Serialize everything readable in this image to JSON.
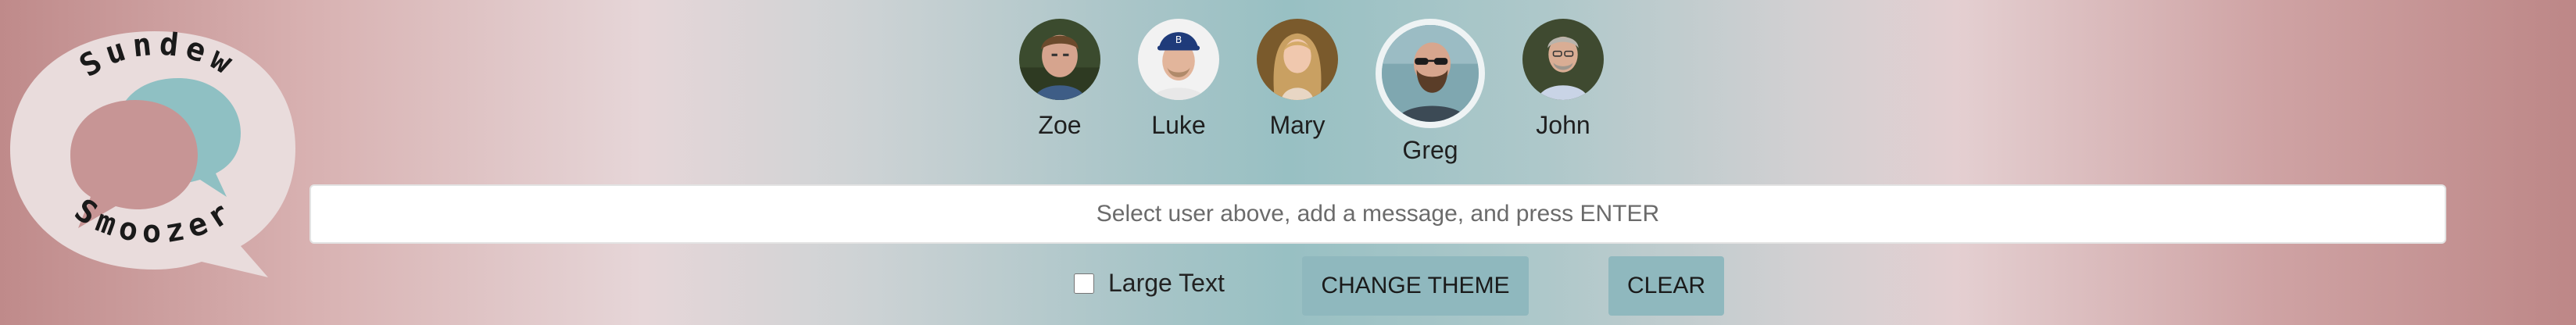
{
  "logo": {
    "text_top": "Sundew",
    "text_bottom": "Smoozer",
    "colors": {
      "bubble": "#e9dcdc",
      "speech_back": "#8fc0c3",
      "speech_front": "#c79595",
      "text": "#1a1a1a"
    }
  },
  "users": [
    {
      "name": "Zoe",
      "avatar_icon": "user-avatar-photo",
      "selected": false
    },
    {
      "name": "Luke",
      "avatar_icon": "user-avatar-photo",
      "selected": false
    },
    {
      "name": "Mary",
      "avatar_icon": "user-avatar-photo",
      "selected": false
    },
    {
      "name": "Greg",
      "avatar_icon": "user-avatar-photo",
      "selected": true
    },
    {
      "name": "John",
      "avatar_icon": "user-avatar-photo",
      "selected": false
    }
  ],
  "message": {
    "value": "",
    "placeholder": "Select user above, add a message, and press ENTER"
  },
  "controls": {
    "large_text_label": "Large Text",
    "large_text_checked": false,
    "change_theme_label": "CHANGE THEME",
    "clear_label": "CLEAR"
  },
  "colors": {
    "button_bg": "#8fb8be",
    "selected_ring": "#eef3f4"
  }
}
